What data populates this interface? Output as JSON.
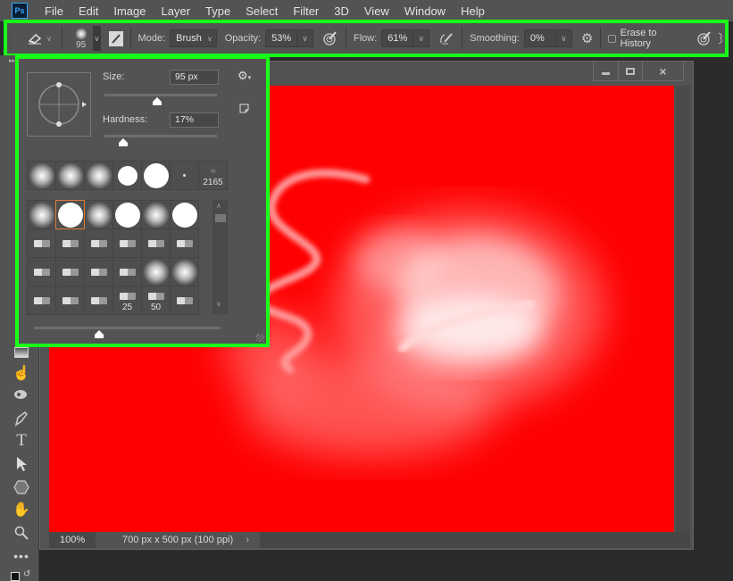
{
  "app": {
    "logo": "Ps"
  },
  "menu": [
    "File",
    "Edit",
    "Image",
    "Layer",
    "Type",
    "Select",
    "Filter",
    "3D",
    "View",
    "Window",
    "Help"
  ],
  "options_bar": {
    "tool_icon": "eraser-icon",
    "brush_size_label": "95",
    "mode_label": "Mode:",
    "mode_value": "Brush",
    "opacity_label": "Opacity:",
    "opacity_value": "53%",
    "flow_label": "Flow:",
    "flow_value": "61%",
    "smoothing_label": "Smoothing:",
    "smoothing_value": "0%",
    "erase_to_history_label": "Erase to History",
    "erase_to_history_checked": false
  },
  "brush_panel": {
    "size_label": "Size:",
    "size_value": "95 px",
    "size_fraction": 0.47,
    "hardness_label": "Hardness:",
    "hardness_value": "17%",
    "hardness_fraction": 0.17,
    "recent_brushes": [
      {
        "type": "soft"
      },
      {
        "type": "soft"
      },
      {
        "type": "soft"
      },
      {
        "type": "hard-small"
      },
      {
        "type": "hard"
      },
      {
        "type": "dot"
      },
      {
        "type": "sampled",
        "num": "2165"
      }
    ],
    "presets": [
      {
        "type": "soft"
      },
      {
        "type": "hard",
        "selected": true
      },
      {
        "type": "soft"
      },
      {
        "type": "hard"
      },
      {
        "type": "soft"
      },
      {
        "type": "hard"
      },
      {
        "type": "tip"
      },
      {
        "type": "tip"
      },
      {
        "type": "tip"
      },
      {
        "type": "tip"
      },
      {
        "type": "tip"
      },
      {
        "type": "tip"
      },
      {
        "type": "tip"
      },
      {
        "type": "tip"
      },
      {
        "type": "tip"
      },
      {
        "type": "tip"
      },
      {
        "type": "soft"
      },
      {
        "type": "soft"
      },
      {
        "type": "tip"
      },
      {
        "type": "tip"
      },
      {
        "type": "tip"
      },
      {
        "type": "tip",
        "num": "25"
      },
      {
        "type": "tip",
        "num": "50"
      },
      {
        "type": "tip"
      }
    ],
    "preview_scale_fraction": 0.35
  },
  "document": {
    "zoom": "100%",
    "info": "700 px x 500 px (100 ppi)",
    "canvas_color": "#ff0000"
  },
  "window_buttons": {
    "minimize": "minimize-icon",
    "maximize": "maximize-icon",
    "close": "close-icon"
  },
  "colors": {
    "highlight": "#19ff19",
    "selected_brush": "#e07a3a"
  }
}
